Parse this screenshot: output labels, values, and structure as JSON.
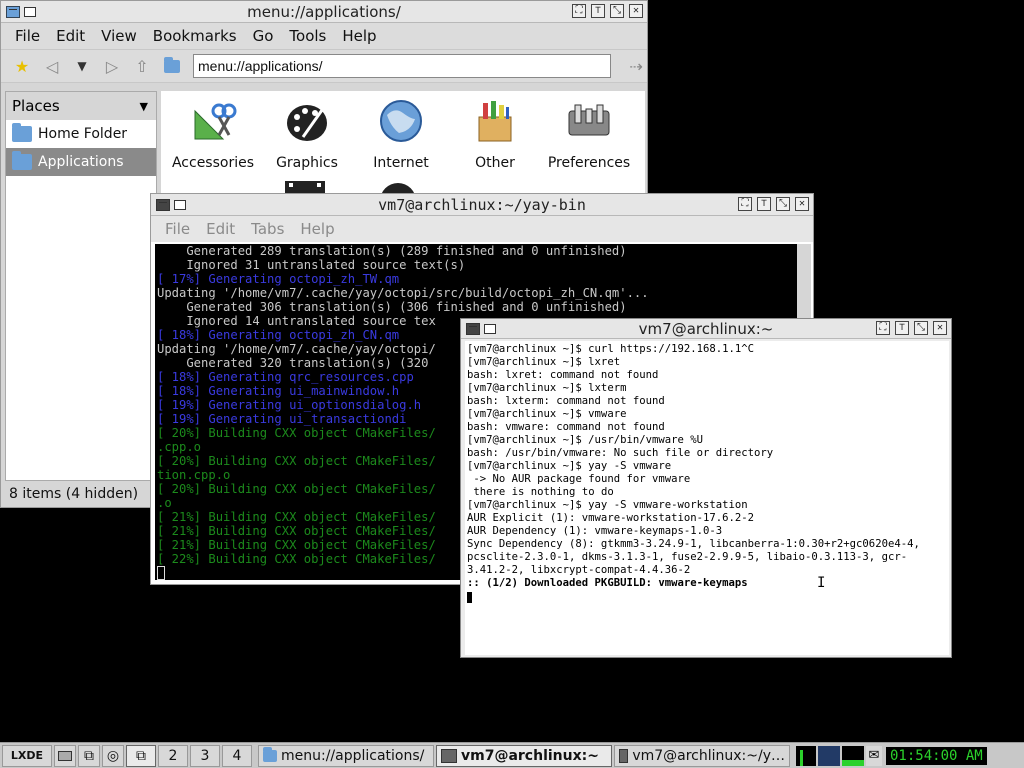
{
  "file_manager": {
    "title": "menu://applications/",
    "menu": [
      "File",
      "Edit",
      "View",
      "Bookmarks",
      "Go",
      "Tools",
      "Help"
    ],
    "address": "menu://applications/",
    "places_label": "Places",
    "places": [
      {
        "label": "Home Folder",
        "icon": "home-folder-icon"
      },
      {
        "label": "Applications",
        "icon": "applications-folder-icon"
      }
    ],
    "apps": [
      {
        "label": "Accessories",
        "icon": "accessories-icon"
      },
      {
        "label": "Graphics",
        "icon": "graphics-icon"
      },
      {
        "label": "Internet",
        "icon": "internet-icon"
      },
      {
        "label": "Other",
        "icon": "other-icon"
      },
      {
        "label": "Preferences",
        "icon": "preferences-icon"
      }
    ],
    "status": "8 items (4 hidden)"
  },
  "lxterminal": {
    "title": "vm7@archlinux:~/yay-bin",
    "menu": [
      "File",
      "Edit",
      "Tabs",
      "Help"
    ],
    "lines": [
      {
        "c": "w",
        "t": "    Generated 289 translation(s) (289 finished and 0 unfinished)"
      },
      {
        "c": "w",
        "t": "    Ignored 31 untranslated source text(s)"
      },
      {
        "c": "b",
        "t": "[ 17%] Generating octopi_zh_TW.qm"
      },
      {
        "c": "w",
        "t": "Updating '/home/vm7/.cache/yay/octopi/src/build/octopi_zh_CN.qm'..."
      },
      {
        "c": "w",
        "t": "    Generated 306 translation(s) (306 finished and 0 unfinished)"
      },
      {
        "c": "w",
        "t": "    Ignored 14 untranslated source tex"
      },
      {
        "c": "b",
        "t": "[ 18%] Generating octopi_zh_CN.qm"
      },
      {
        "c": "w",
        "t": "Updating '/home/vm7/.cache/yay/octopi/"
      },
      {
        "c": "w",
        "t": "    Generated 320 translation(s) (320"
      },
      {
        "c": "b",
        "t": "[ 18%] Generating qrc_resources.cpp"
      },
      {
        "c": "b",
        "t": "[ 18%] Generating ui_mainwindow.h"
      },
      {
        "c": "b",
        "t": "[ 19%] Generating ui_optionsdialog.h"
      },
      {
        "c": "b",
        "t": "[ 19%] Generating ui_transactiondi"
      },
      {
        "c": "g",
        "t": "[ 20%] Building CXX object CMakeFiles/"
      },
      {
        "c": "g",
        "t": ".cpp.o"
      },
      {
        "c": "g",
        "t": "[ 20%] Building CXX object CMakeFiles/"
      },
      {
        "c": "g",
        "t": "tion.cpp.o"
      },
      {
        "c": "g",
        "t": "[ 20%] Building CXX object CMakeFiles/"
      },
      {
        "c": "g",
        "t": ".o"
      },
      {
        "c": "g",
        "t": "[ 21%] Building CXX object CMakeFiles/"
      },
      {
        "c": "g",
        "t": "[ 21%] Building CXX object CMakeFiles/"
      },
      {
        "c": "g",
        "t": "[ 21%] Building CXX object CMakeFiles/"
      },
      {
        "c": "g",
        "t": "[ 22%] Building CXX object CMakeFiles/"
      }
    ]
  },
  "xterm": {
    "title": "vm7@archlinux:~",
    "lines": [
      "[vm7@archlinux ~]$ curl https://192.168.1.1^C",
      "[vm7@archlinux ~]$ lxret",
      "bash: lxret: command not found",
      "[vm7@archlinux ~]$ lxterm",
      "bash: lxterm: command not found",
      "[vm7@archlinux ~]$ vmware",
      "bash: vmware: command not found",
      "[vm7@archlinux ~]$ /usr/bin/vmware %U",
      "bash: /usr/bin/vmware: No such file or directory",
      "[vm7@archlinux ~]$ yay -S vmware",
      " -> No AUR package found for vmware",
      " there is nothing to do",
      "[vm7@archlinux ~]$ yay -S vmware-workstation",
      "AUR Explicit (1): vmware-workstation-17.6.2-2",
      "AUR Dependency (1): vmware-keymaps-1.0-3",
      "Sync Dependency (8): gtkmm3-3.24.9-1, libcanberra-1:0.30+r2+gc0620e4-4, pcsclite-2.3.0-1, dkms-3.1.3-1, fuse2-2.9.9-5, libaio-0.3.113-3, gcr-3.41.2-2, libxcrypt-compat-4.4.36-2",
      ":: (1/2) Downloaded PKGBUILD: vmware-keymaps"
    ]
  },
  "taskbar": {
    "workspaces": [
      "2",
      "3",
      "4"
    ],
    "tasks": [
      {
        "label": "menu://applications/",
        "active": false
      },
      {
        "label": "vm7@archlinux:~",
        "active": true
      },
      {
        "label": "vm7@archlinux:~/y…",
        "active": false
      }
    ],
    "clock": "01:54:00 AM",
    "start_label": "LXDE"
  }
}
